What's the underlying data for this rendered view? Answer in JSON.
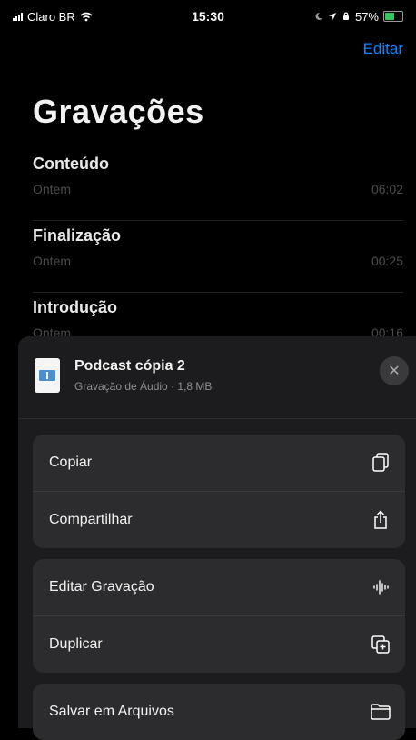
{
  "status_bar": {
    "carrier": "Claro BR",
    "time": "15:30",
    "battery": "57%",
    "battery_level": 0.57
  },
  "nav": {
    "edit_label": "Editar"
  },
  "page": {
    "title": "Gravações"
  },
  "recordings": [
    {
      "name": "Conteúdo",
      "date": "Ontem",
      "duration": "06:02"
    },
    {
      "name": "Finalização",
      "date": "Ontem",
      "duration": "00:25"
    },
    {
      "name": "Introdução",
      "date": "Ontem",
      "duration": "00:16"
    }
  ],
  "share_sheet": {
    "file_name": "Podcast cópia 2",
    "file_meta": "Gravação de Áudio · 1,8 MB",
    "group1": [
      {
        "label": "Copiar",
        "icon": "copy-icon"
      },
      {
        "label": "Compartilhar",
        "icon": "share-icon"
      }
    ],
    "group2": [
      {
        "label": "Editar Gravação",
        "icon": "waveform-icon"
      },
      {
        "label": "Duplicar",
        "icon": "duplicate-icon"
      }
    ],
    "group3": [
      {
        "label": "Salvar em Arquivos",
        "icon": "folder-icon"
      }
    ]
  },
  "colors": {
    "accent": "#0a84ff",
    "battery": "#34c759"
  }
}
